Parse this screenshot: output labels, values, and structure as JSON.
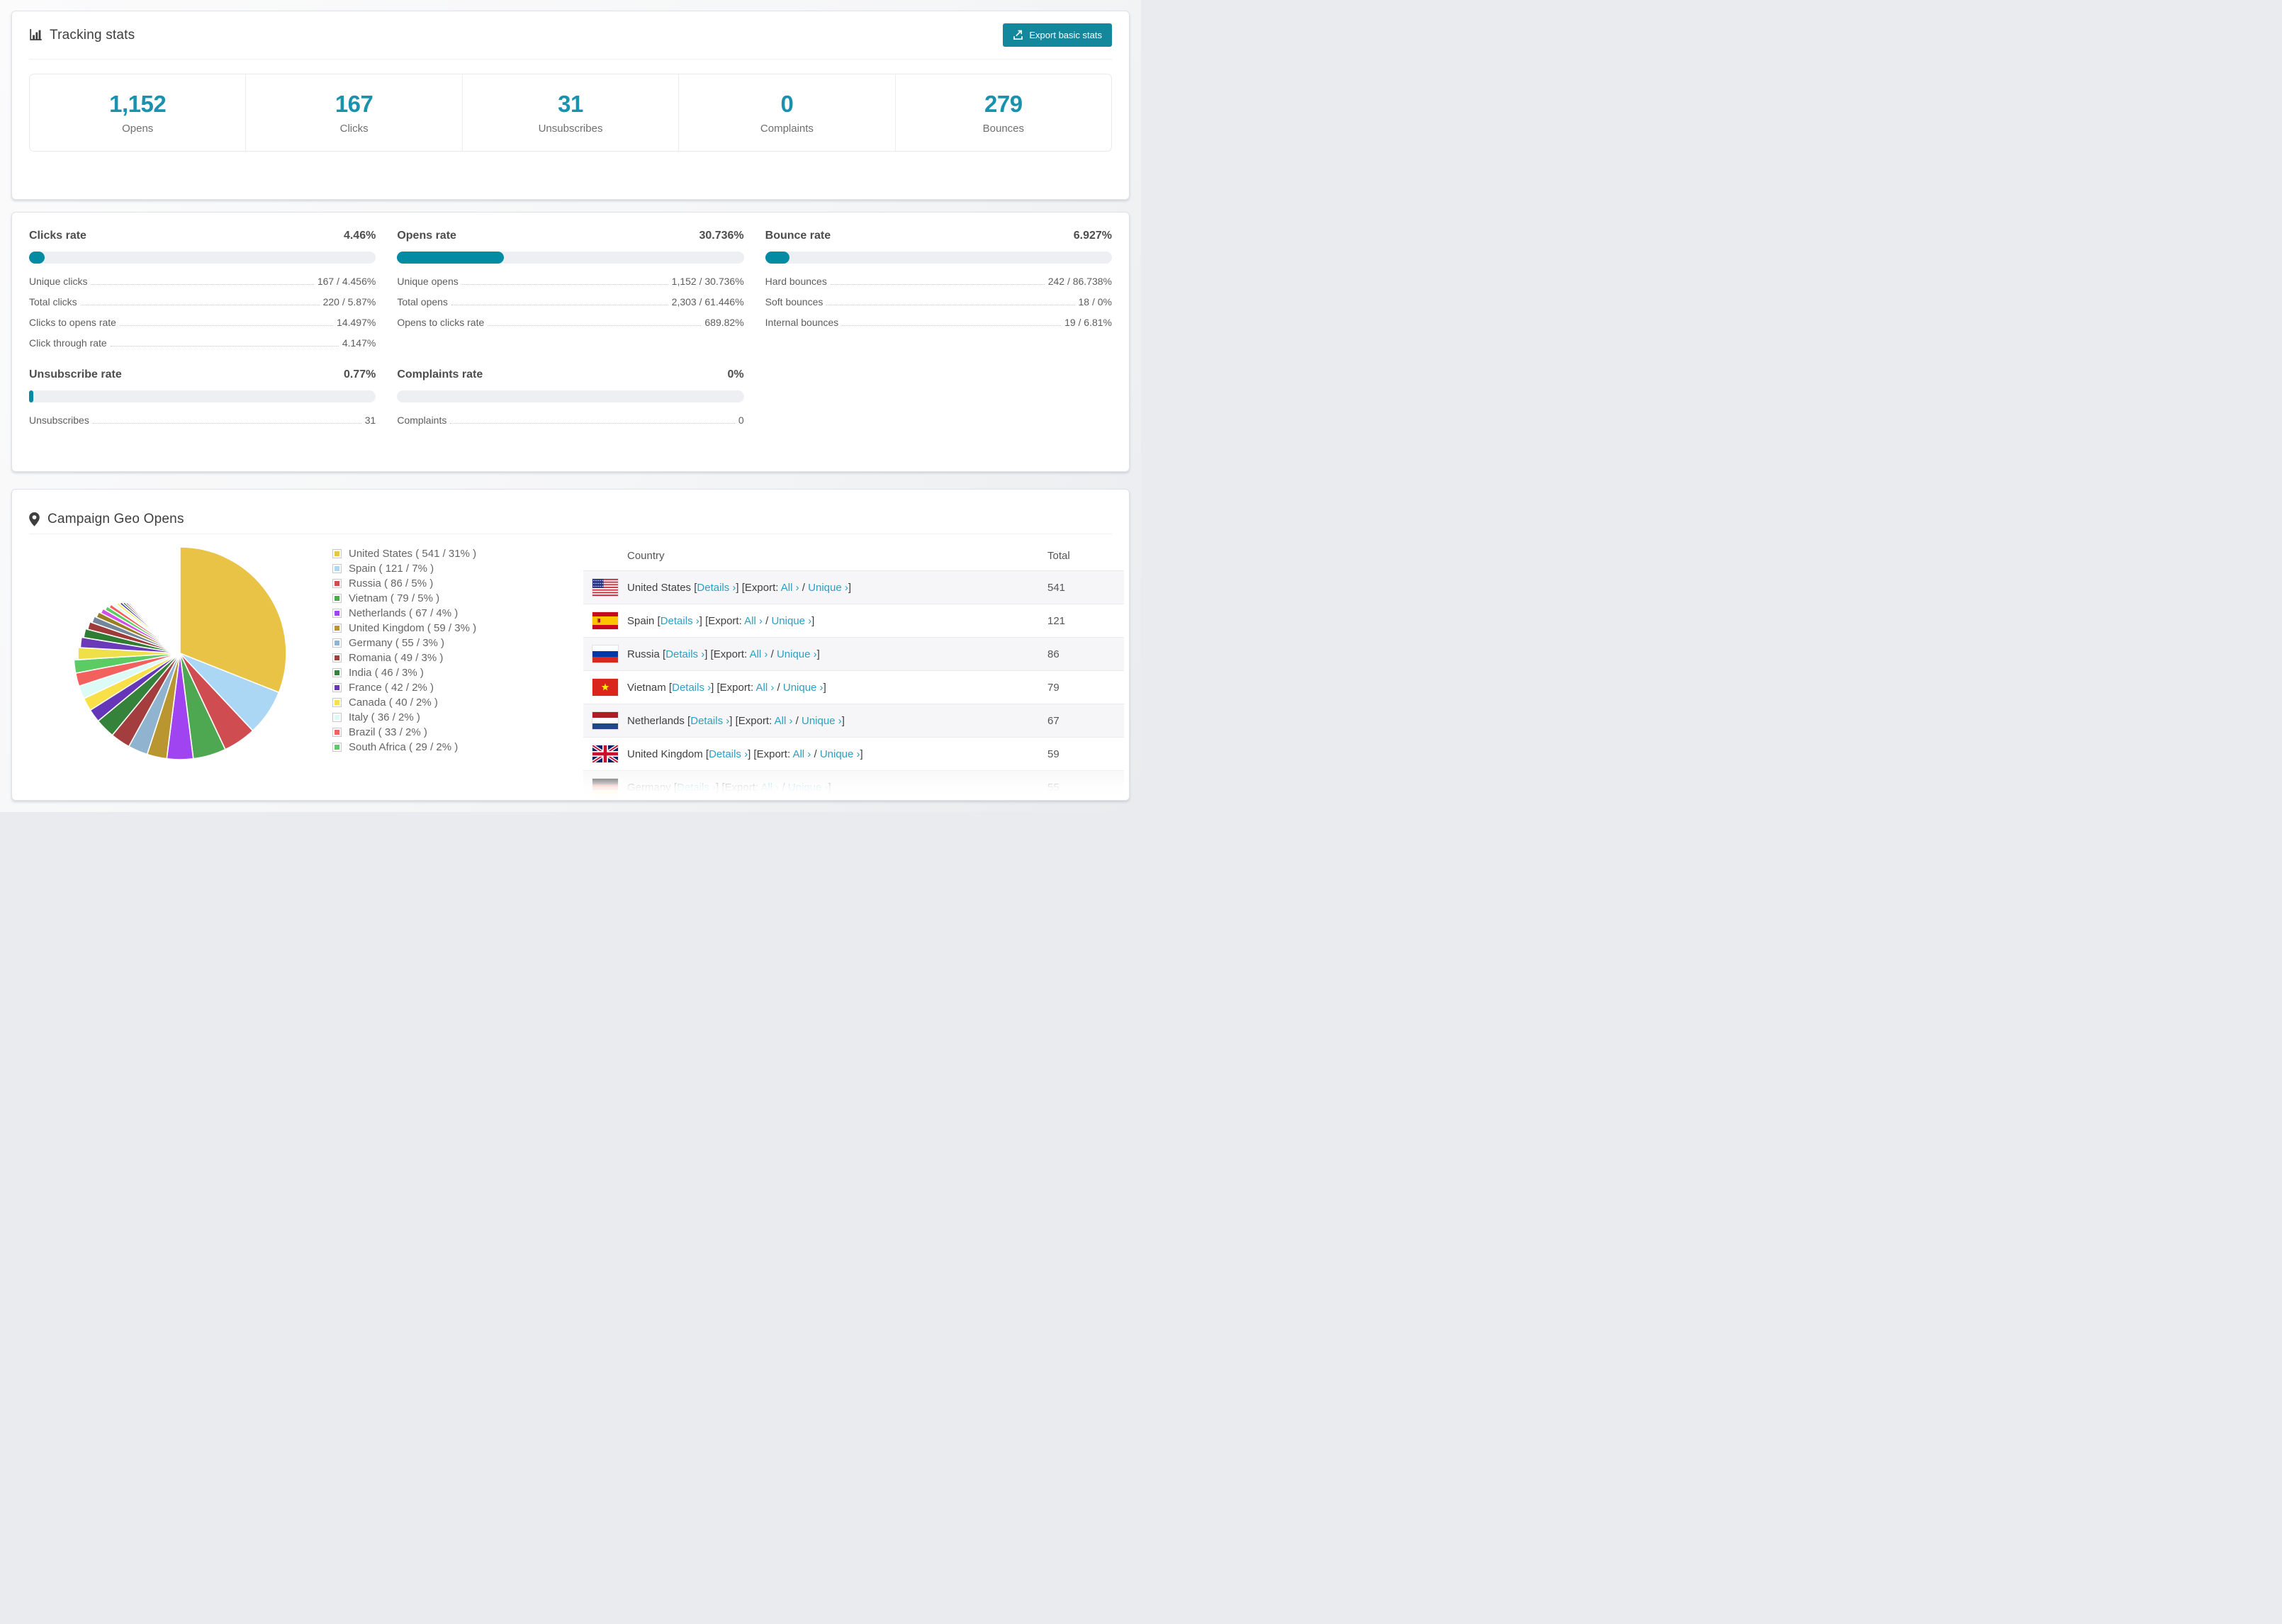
{
  "colors": {
    "accent_bar": "#048ba4",
    "accent_number": "#1a91ad",
    "button_bg": "#15879d",
    "link": "#2d9fc0",
    "row_stripe": "#f6f6f8"
  },
  "tracking": {
    "title": "Tracking stats",
    "export_button": "Export basic stats",
    "summary": [
      {
        "value": "1,152",
        "label": "Opens"
      },
      {
        "value": "167",
        "label": "Clicks"
      },
      {
        "value": "31",
        "label": "Unsubscribes"
      },
      {
        "value": "0",
        "label": "Complaints"
      },
      {
        "value": "279",
        "label": "Bounces"
      }
    ]
  },
  "rates": {
    "sections": [
      {
        "id": "clicks",
        "title": "Clicks rate",
        "value": "4.46%",
        "pct": 4.46,
        "rows": [
          {
            "label": "Unique clicks",
            "value": "167 / 4.456%"
          },
          {
            "label": "Total clicks",
            "value": "220 / 5.87%"
          },
          {
            "label": "Clicks to opens rate",
            "value": "14.497%"
          },
          {
            "label": "Click through rate",
            "value": "4.147%"
          }
        ]
      },
      {
        "id": "opens",
        "title": "Opens rate",
        "value": "30.736%",
        "pct": 30.736,
        "rows": [
          {
            "label": "Unique opens",
            "value": "1,152 / 30.736%"
          },
          {
            "label": "Total opens",
            "value": "2,303 / 61.446%"
          },
          {
            "label": "Opens to clicks rate",
            "value": "689.82%"
          }
        ]
      },
      {
        "id": "bounce",
        "title": "Bounce rate",
        "value": "6.927%",
        "pct": 6.927,
        "rows": [
          {
            "label": "Hard bounces",
            "value": "242 / 86.738%"
          },
          {
            "label": "Soft bounces",
            "value": "18 / 0%"
          },
          {
            "label": "Internal bounces",
            "value": "19 / 6.81%"
          }
        ]
      },
      {
        "id": "unsubscribe",
        "title": "Unsubscribe rate",
        "value": "0.77%",
        "pct": 0.77,
        "rows": [
          {
            "label": "Unsubscribes",
            "value": "31"
          }
        ]
      },
      {
        "id": "complaints",
        "title": "Complaints rate",
        "value": "0%",
        "pct": 0,
        "rows": [
          {
            "label": "Complaints",
            "value": "0"
          }
        ]
      }
    ]
  },
  "geo": {
    "title": "Campaign Geo Opens",
    "legend": [
      {
        "label": "United States ( 541 / 31% )",
        "color": "#e8c345"
      },
      {
        "label": "Spain ( 121 / 7% )",
        "color": "#abd7f5"
      },
      {
        "label": "Russia ( 86 / 5% )",
        "color": "#cf4d50"
      },
      {
        "label": "Vietnam ( 79 / 5% )",
        "color": "#4ea852"
      },
      {
        "label": "Netherlands ( 67 / 4% )",
        "color": "#a044f2"
      },
      {
        "label": "United Kingdom ( 59 / 3% )",
        "color": "#b99630"
      },
      {
        "label": "Germany ( 55 / 3% )",
        "color": "#90b4cf"
      },
      {
        "label": "Romania ( 49 / 3% )",
        "color": "#a43d3d"
      },
      {
        "label": "India ( 46 / 3% )",
        "color": "#35823a"
      },
      {
        "label": "France ( 42 / 2% )",
        "color": "#6636b8"
      },
      {
        "label": "Canada ( 40 / 2% )",
        "color": "#f9e049"
      },
      {
        "label": "Italy ( 36 / 2% )",
        "color": "#dcfbf7"
      },
      {
        "label": "Brazil ( 33 / 2% )",
        "color": "#f2615e"
      },
      {
        "label": "South Africa ( 29 / 2% )",
        "color": "#5bcc63"
      }
    ],
    "table": {
      "country_header": "Country",
      "total_header": "Total",
      "link_details": "Details ›",
      "link_all": "All ›",
      "link_unique": "Unique ›",
      "fmt": {
        "open": " [",
        "export_prefix": "] [Export: ",
        "slash": " / ",
        "close": "]"
      },
      "rows": [
        {
          "country": "United States",
          "flag": "us",
          "total": "541"
        },
        {
          "country": "Spain",
          "flag": "es",
          "total": "121"
        },
        {
          "country": "Russia",
          "flag": "ru",
          "total": "86"
        },
        {
          "country": "Vietnam",
          "flag": "vn",
          "total": "79"
        },
        {
          "country": "Netherlands",
          "flag": "nl",
          "total": "67"
        },
        {
          "country": "United Kingdom",
          "flag": "gb",
          "total": "59"
        },
        {
          "country": "Germany",
          "flag": "de",
          "total": "55"
        }
      ]
    }
  },
  "chart_data": {
    "type": "pie",
    "title": "Campaign Geo Opens",
    "legend_position": "right",
    "slices": [
      {
        "name": "United States",
        "value": 541,
        "pct": 31,
        "color": "#e8c345"
      },
      {
        "name": "Spain",
        "value": 121,
        "pct": 7,
        "color": "#abd7f5"
      },
      {
        "name": "Russia",
        "value": 86,
        "pct": 5,
        "color": "#cf4d50"
      },
      {
        "name": "Vietnam",
        "value": 79,
        "pct": 5,
        "color": "#4ea852"
      },
      {
        "name": "Netherlands",
        "value": 67,
        "pct": 4,
        "color": "#a044f2"
      },
      {
        "name": "United Kingdom",
        "value": 59,
        "pct": 3,
        "color": "#b99630"
      },
      {
        "name": "Germany",
        "value": 55,
        "pct": 3,
        "color": "#90b4cf"
      },
      {
        "name": "Romania",
        "value": 49,
        "pct": 3,
        "color": "#a43d3d"
      },
      {
        "name": "India",
        "value": 46,
        "pct": 3,
        "color": "#35823a"
      },
      {
        "name": "France",
        "value": 42,
        "pct": 2,
        "color": "#6636b8"
      },
      {
        "name": "Canada",
        "value": 40,
        "pct": 2,
        "color": "#f9e049"
      },
      {
        "name": "Italy",
        "value": 36,
        "pct": 2,
        "color": "#dcfbf7"
      },
      {
        "name": "Brazil",
        "value": 33,
        "pct": 2,
        "color": "#f2615e"
      },
      {
        "name": "South Africa",
        "value": 29,
        "pct": 2,
        "color": "#5bcc63"
      }
    ],
    "others_pcts": [
      1.9,
      1.67,
      1.47,
      1.3,
      1.14,
      1.0,
      0.88,
      0.78,
      0.68,
      0.6,
      0.53,
      0.47,
      0.41,
      0.36,
      0.32,
      0.28,
      0.25,
      0.22,
      0.19,
      0.17,
      0.15,
      0.13,
      0.12,
      0.1,
      0.09,
      0.08,
      0.07,
      0.06,
      0.055,
      0.05,
      0.04,
      0.04,
      0.03,
      0.03,
      0.025,
      0.02
    ],
    "others_colors": [
      "#efe04a",
      "#6a3ab8",
      "#2f7d33",
      "#9e3a3a",
      "#74879a",
      "#9a7f22",
      "#d24fe8",
      "#5ccf63",
      "#f75d5c",
      "#e7fdfb",
      "#f6ef55",
      "#3b2e8f",
      "#1f5d2b",
      "#8c2e2e",
      "#60748a",
      "#b5952f",
      "#e44fc3",
      "#4db552",
      "#ef4444",
      "#c7eef9",
      "#efe14e",
      "#4527a0",
      "#2e7d32",
      "#a03b3b",
      "#8fa3b5",
      "#a08327",
      "#d94ff0",
      "#66bb6a",
      "#ff6b6b",
      "#e0f7fa",
      "#f4e04d",
      "#512da8",
      "#1b5e20",
      "#7f1f1f",
      "#7a8ca0",
      "#8d6e1e"
    ]
  }
}
